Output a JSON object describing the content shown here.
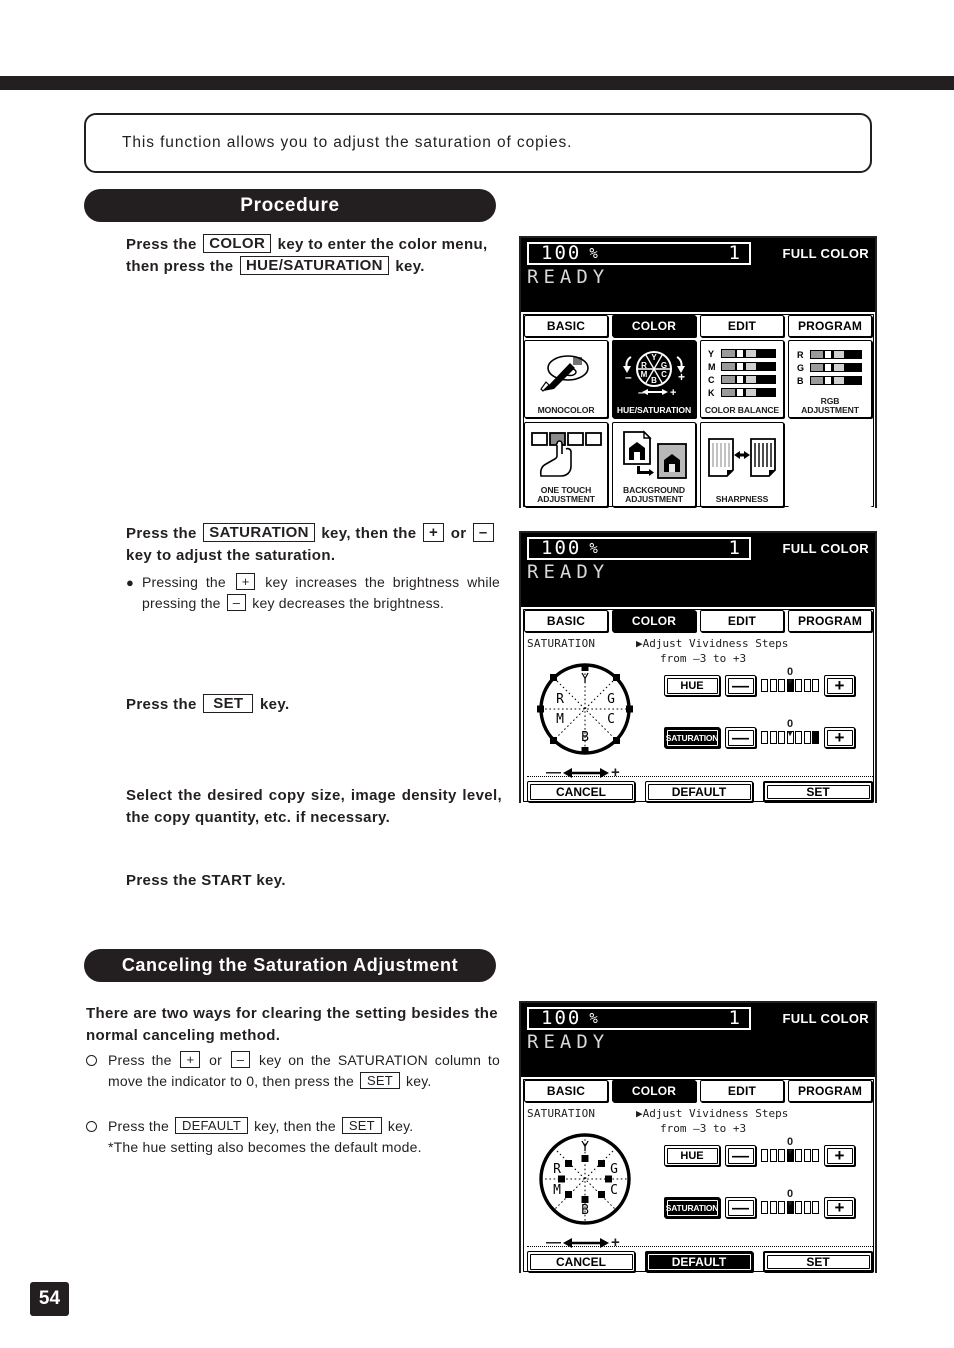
{
  "page": {
    "number": "54"
  },
  "intro": {
    "text": "This function allows you to adjust the saturation of copies."
  },
  "banners": {
    "procedure": "Procedure",
    "canceling": "Canceling the Saturation Adjustment"
  },
  "steps": {
    "step1": {
      "a": "Press the",
      "key_color": "COLOR",
      "b": "key to enter the color menu, then press the",
      "key_huesat": "HUE/SATURATION",
      "c": "key."
    },
    "step2": {
      "a": "Press the",
      "key_saturation": "SATURATION",
      "b": "key, then the",
      "key_plus": "+",
      "c": "or",
      "key_minus": "–",
      "d": "key to adjust the saturation.",
      "note_a": "Pressing the",
      "note_plus": "+",
      "note_b": "key increases the brightness while pressing the",
      "note_minus": "–",
      "note_c": "key decreases the brightness."
    },
    "step3": {
      "a": "Press the",
      "key_set": "SET",
      "b": "key."
    },
    "step4": {
      "text": "Select the desired copy size, image density level, the copy quantity, etc. if necessary."
    },
    "step5": {
      "text": "Press the START key."
    }
  },
  "canceling": {
    "lead": "There are two ways for clearing the setting besides the normal canceling method.",
    "item1": {
      "a": "Press the",
      "key_plus": "+",
      "b": "or",
      "key_minus": "–",
      "c": "key on the SATURATION column to move the indicator to 0, then press the",
      "key_set": "SET",
      "d": "key."
    },
    "item2": {
      "a": "Press the",
      "key_default": "DEFAULT",
      "b": "key, then the",
      "key_set": "SET",
      "c": "key.",
      "footnote": "*The hue setting also becomes the default mode."
    }
  },
  "lcd": {
    "header": {
      "ratio": "100",
      "percent": "%",
      "quantity": "1",
      "mode": "FULL COLOR",
      "status": "READY"
    },
    "tabs": [
      {
        "label": "BASIC",
        "active": false
      },
      {
        "label": "COLOR",
        "active": true
      },
      {
        "label": "EDIT",
        "active": false
      },
      {
        "label": "PROGRAM",
        "active": false
      }
    ],
    "color_menu": {
      "items": [
        {
          "label": "MONOCOLOR",
          "icon": "palette-brush-icon",
          "selected": false
        },
        {
          "label": "HUE/SATURATION",
          "icon": "color-wheel-icon",
          "selected": true
        },
        {
          "label": "COLOR BALANCE",
          "icon": "ymck-bars-icon",
          "selected": false
        },
        {
          "label": "RGB\nADJUSTMENT",
          "icon": "rgb-bars-icon",
          "selected": false
        },
        {
          "label": "ONE TOUCH\nADJUSTMENT",
          "icon": "finger-press-icon",
          "selected": false
        },
        {
          "label": "BACKGROUND\nADJUSTMENT",
          "icon": "document-background-icon",
          "selected": false
        },
        {
          "label": "SHARPNESS",
          "icon": "sharpness-pages-icon",
          "selected": false
        }
      ],
      "color_balance_rows": [
        "Y",
        "M",
        "C",
        "K"
      ],
      "rgb_rows": [
        "R",
        "G",
        "B"
      ]
    },
    "saturation_screen": {
      "title": "SATURATION",
      "desc_line1": "▶Adjust Vividness Steps",
      "desc_line2": "from –3 to +3",
      "wheel_labels": {
        "top": "Y",
        "left": "R",
        "right": "G",
        "bottom_left": "M",
        "bottom_right": "C",
        "bottom": "B"
      },
      "wheel_minus": "—",
      "wheel_plus": "+",
      "rows": [
        {
          "name": "HUE",
          "dark": false,
          "minus": "—",
          "plus": "+",
          "zero": "0"
        },
        {
          "name": "SATURATION",
          "dark": true,
          "minus": "—",
          "plus": "+",
          "zero": "0"
        }
      ],
      "buttons": [
        {
          "label": "CANCEL",
          "dark": false,
          "thick": false
        },
        {
          "label": "DEFAULT",
          "dark": false,
          "thick": false
        },
        {
          "label": "SET",
          "dark": false,
          "thick": true
        }
      ]
    },
    "panel2": {
      "hue_steps": 7,
      "hue_active_index": 3,
      "sat_steps": 7,
      "sat_active_index": 6,
      "default_dark": false,
      "wheel_radius_ratio": 0.92
    },
    "panel3": {
      "hue_steps": 7,
      "hue_active_index": 3,
      "sat_steps": 7,
      "sat_active_index": 3,
      "default_dark": true,
      "wheel_radius_ratio": 0.45
    }
  },
  "colors": {
    "ink": "#231f20",
    "paper": "#ffffff"
  }
}
